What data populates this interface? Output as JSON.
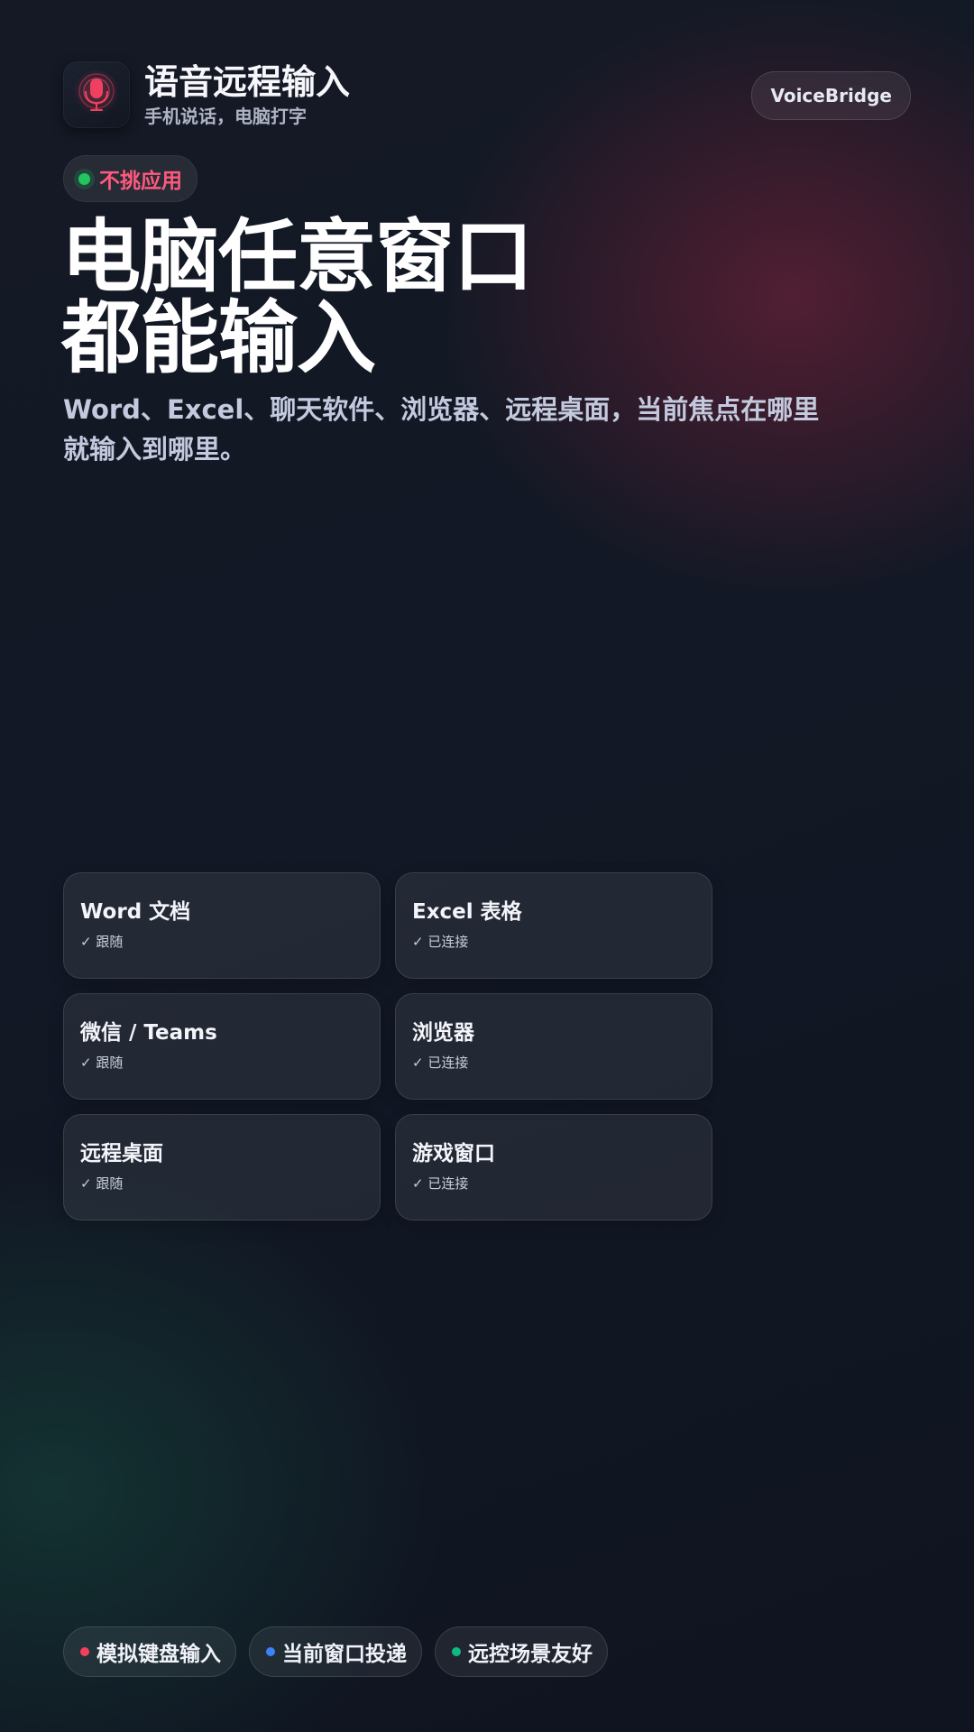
{
  "header": {
    "app_icon": "microphone-icon",
    "title": "语音远程输入",
    "subtitle": "手机说话，电脑打字",
    "brand_pill": "VoiceBridge"
  },
  "hero": {
    "tag_label": "不挑应用",
    "headline_line1": "电脑任意窗口",
    "headline_line2": "都能输入",
    "description": "Word、Excel、聊天软件、浏览器、远程桌面，当前焦点在哪里就输入到哪里。"
  },
  "cards": [
    {
      "title": "Word 文档",
      "status": "✓ 跟随"
    },
    {
      "title": "Excel 表格",
      "status": "✓ 已连接"
    },
    {
      "title": "微信 / Teams",
      "status": "✓ 跟随"
    },
    {
      "title": "浏览器",
      "status": "✓ 已连接"
    },
    {
      "title": "远程桌面",
      "status": "✓ 跟随"
    },
    {
      "title": "游戏窗口",
      "status": "✓ 已连接"
    }
  ],
  "chips": [
    {
      "label": "模拟键盘输入",
      "dot_color": "#f43f5e"
    },
    {
      "label": "当前窗口投递",
      "dot_color": "#3b82f6"
    },
    {
      "label": "远控场景友好",
      "dot_color": "#10b981"
    }
  ],
  "colors": {
    "accent": "#ff5a7d",
    "status_green": "#22c55e",
    "background": "#131926"
  }
}
